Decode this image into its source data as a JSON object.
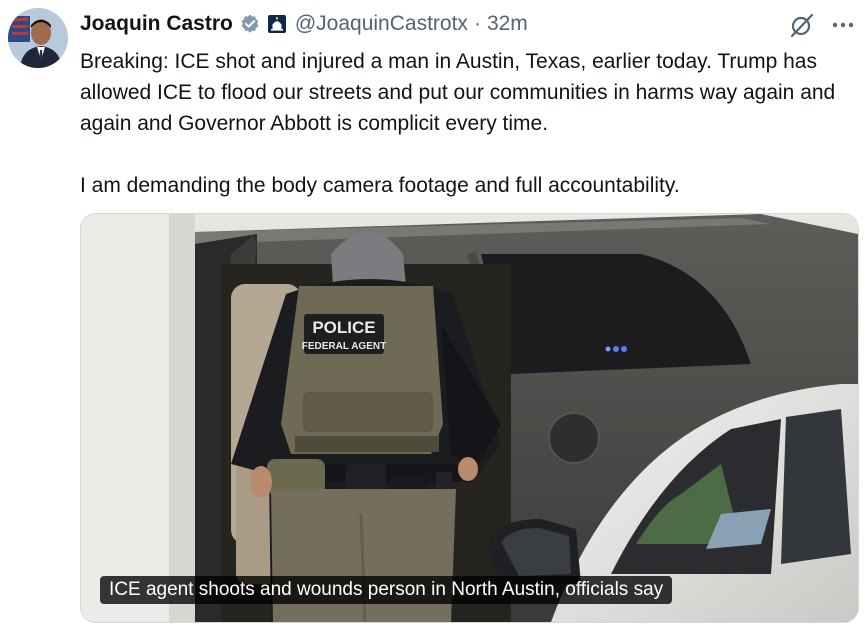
{
  "author": {
    "display_name": "Joaquin Castro",
    "handle": "@JoaquinCastrotx",
    "separator": "·",
    "time": "32m"
  },
  "icons": {
    "verified": "verified-badge-icon",
    "government": "government-building-badge-icon",
    "grok": "grok-icon",
    "more": "more-horizontal-icon"
  },
  "tweet": {
    "paragraph_1": "Breaking: ICE shot and injured a man in Austin, Texas, earlier today. Trump has allowed ICE to flood our streets and put our communities in harms way again and again and Governor Abbott is complicit every time.",
    "paragraph_2": "I am demanding the body camera footage and full accountability."
  },
  "media": {
    "caption": "ICE agent shoots and wounds person in North Austin, officials say",
    "vest_text_1": "POLICE",
    "vest_text_2": "FEDERAL AGENT"
  },
  "colors": {
    "verified_blue": "#1d9bf0",
    "text_primary": "#0f1419",
    "text_secondary": "#536471"
  }
}
